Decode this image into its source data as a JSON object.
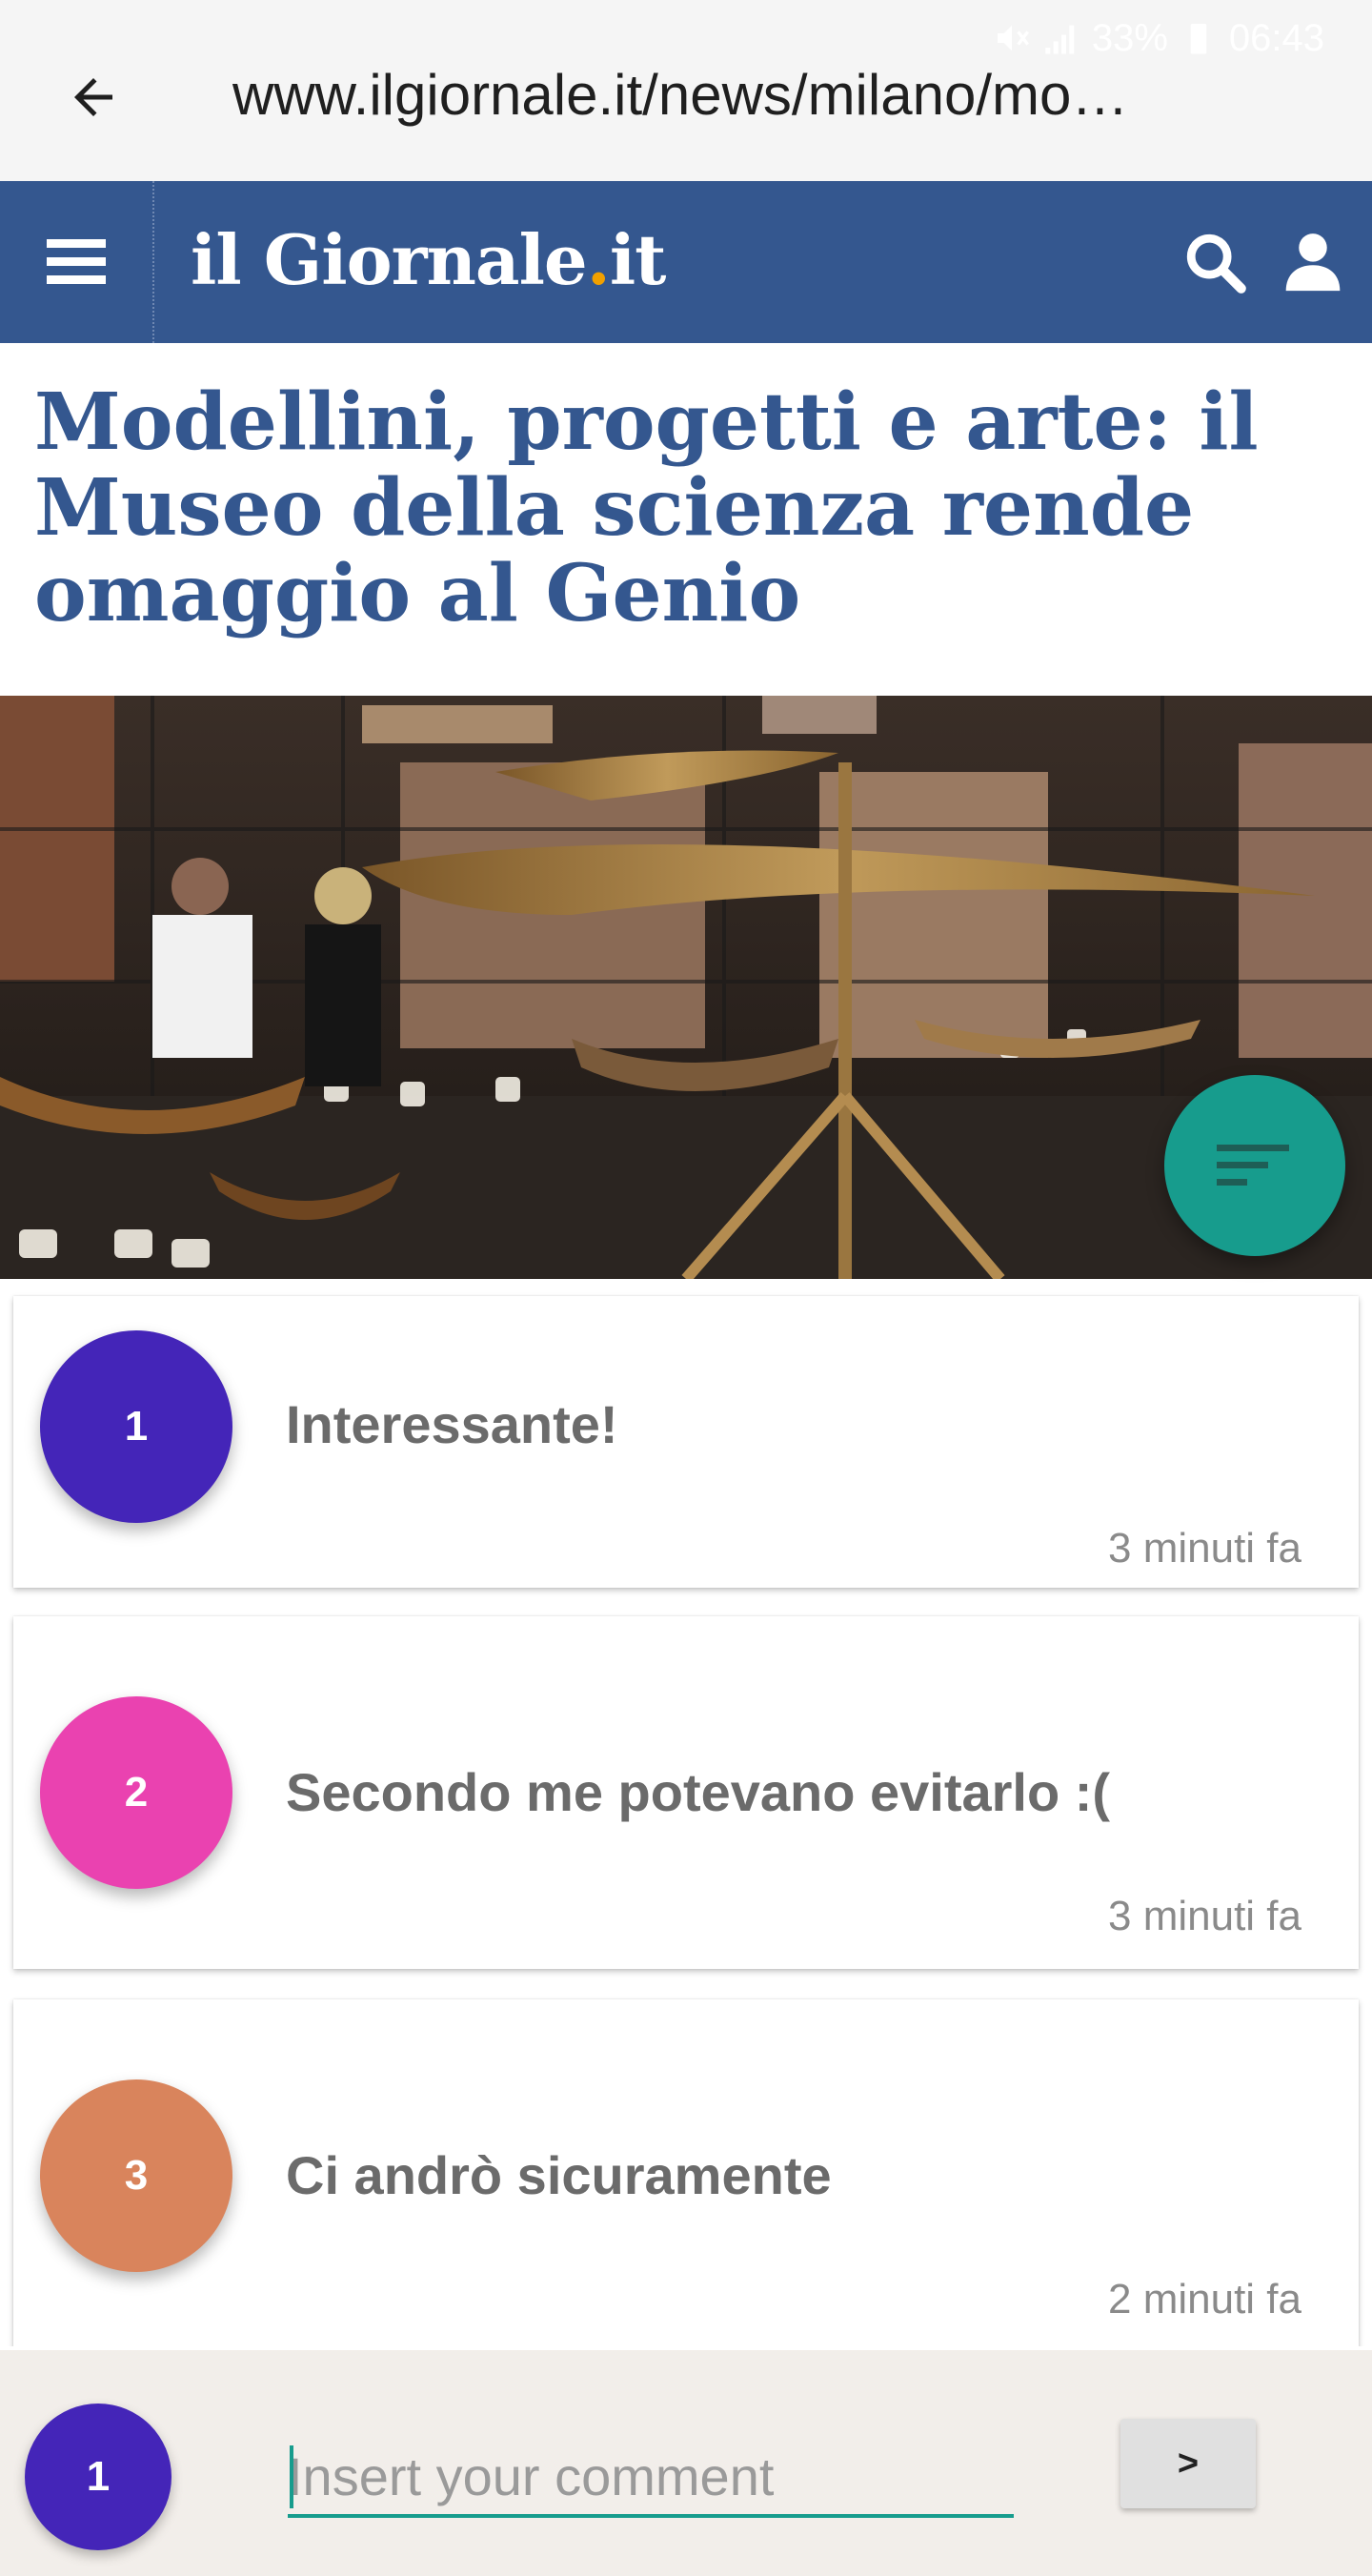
{
  "status_bar": {
    "battery": "33%",
    "time": "06:43",
    "icons": [
      "mute-icon",
      "signal-icon",
      "battery-icon"
    ]
  },
  "browser": {
    "url": "www.ilgiornale.it/news/milano/mo…",
    "back_icon": "arrow-left-icon"
  },
  "site_header": {
    "logo_main": "il Giornale",
    "logo_dot": ".",
    "logo_tld": "it",
    "icons": [
      "menu-icon",
      "search-icon",
      "user-icon"
    ],
    "colors": {
      "background": "#34578f",
      "logo_dot": "#f1a000"
    }
  },
  "article": {
    "title": "Modellini, progetti e arte: il Museo della scienza rende omaggio al Genio"
  },
  "fab": {
    "icon": "sort-icon",
    "color": "#179c8d"
  },
  "comments": [
    {
      "badge": "1",
      "text": "Interessante!",
      "time": "3 minuti fa",
      "color": "#4425b8"
    },
    {
      "badge": "2",
      "text": "Secondo me potevano evitarlo :(",
      "time": "3 minuti fa",
      "color": "#ea42b0"
    },
    {
      "badge": "3",
      "text": "Ci andrò sicuramente",
      "time": "2 minuti fa",
      "color": "#d9845c"
    }
  ],
  "composer": {
    "user_badge": "1",
    "placeholder": "Insert your comment",
    "value": "",
    "send_label": ">"
  }
}
